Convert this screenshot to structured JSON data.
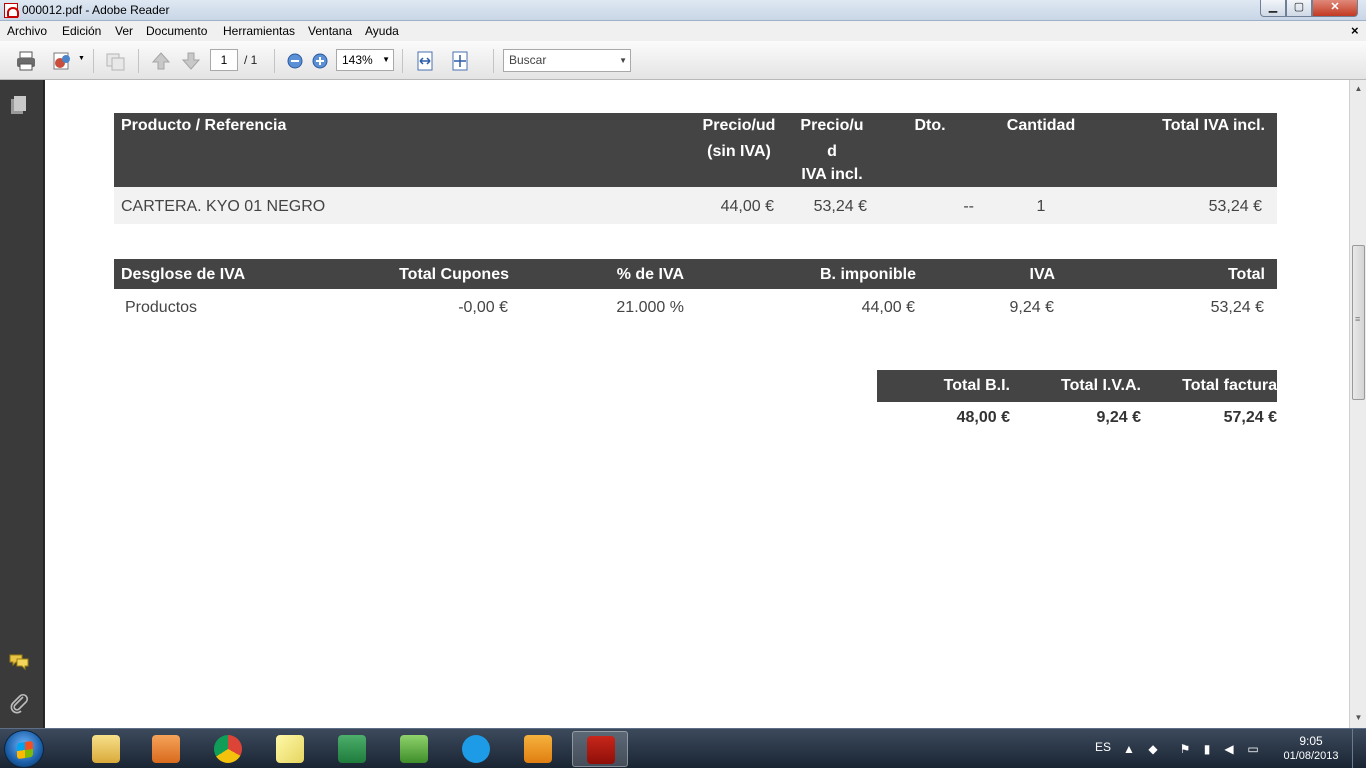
{
  "window": {
    "title": "000012.pdf - Adobe Reader",
    "buttons": {
      "minimize": "▁",
      "maximize": "▢",
      "close": "✕"
    }
  },
  "menubar": {
    "items": [
      "Archivo",
      "Edición",
      "Ver",
      "Documento",
      "Herramientas",
      "Ventana",
      "Ayuda"
    ],
    "close_doc": "×"
  },
  "toolbar": {
    "page_current": "1",
    "page_total": "/ 1",
    "zoom": "143%",
    "search_placeholder": "Buscar",
    "dropdown_arrow": "▼"
  },
  "invoice": {
    "products": {
      "headers": {
        "product": "Producto / Referencia",
        "price_net_1": "Precio/ud",
        "price_net_2": "(sin IVA)",
        "price_gross_1": "Precio/u",
        "price_gross_2": "d",
        "price_gross_3": "IVA incl.",
        "discount": "Dto.",
        "quantity": "Cantidad",
        "total": "Total IVA incl."
      },
      "rows": [
        {
          "product": "CARTERA. KYO 01 NEGRO",
          "price_net": "44,00 €",
          "price_gross": "53,24 €",
          "discount": "--",
          "quantity": "1",
          "total": "53,24 €"
        }
      ]
    },
    "vat_breakdown": {
      "headers": {
        "label": "Desglose de IVA",
        "coupons": "Total Cupones",
        "rate": "% de IVA",
        "base": "B. imponible",
        "vat": "IVA",
        "total": "Total"
      },
      "rows": [
        {
          "label": "Productos",
          "coupons": "-0,00 €",
          "rate": "21.000 %",
          "base": "44,00 €",
          "vat": "9,24 €",
          "total": "53,24 €"
        }
      ]
    },
    "summary": {
      "headers": {
        "base": "Total B.I.",
        "vat": "Total I.V.A.",
        "total": "Total factura"
      },
      "values": {
        "base": "48,00 €",
        "vat": "9,24 €",
        "total": "57,24 €"
      }
    }
  },
  "taskbar": {
    "apps": [
      "windows-explorer",
      "media-player",
      "chrome",
      "sticky-notes",
      "excel",
      "project",
      "skype",
      "outlook",
      "adobe-reader"
    ],
    "language": "ES",
    "time": "9:05",
    "date": "01/08/2013"
  }
}
